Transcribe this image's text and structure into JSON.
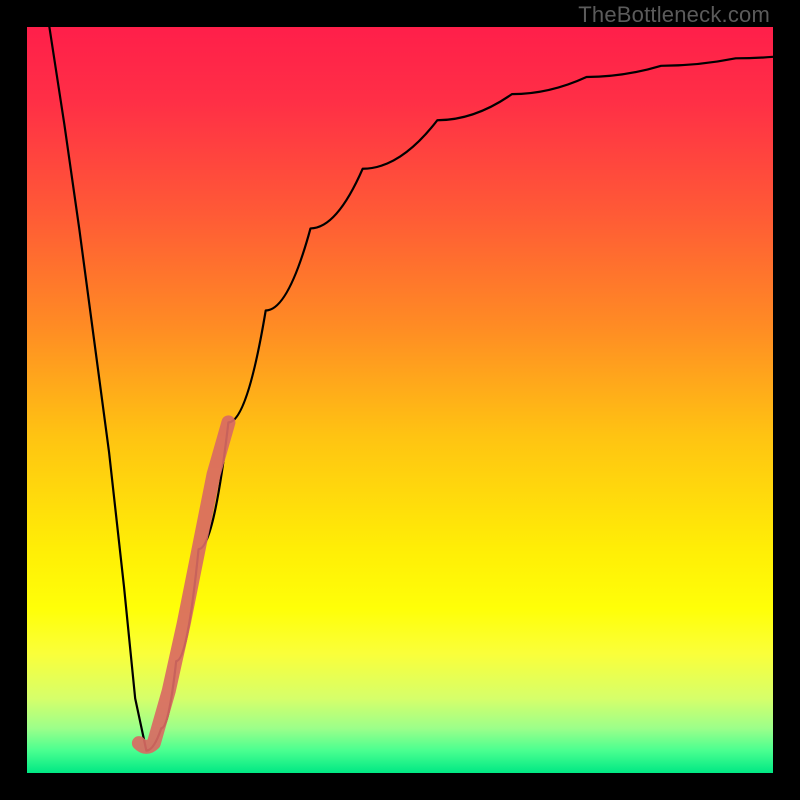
{
  "watermark": "TheBottleneck.com",
  "chart_data": {
    "type": "line",
    "title": "",
    "xlabel": "",
    "ylabel": "",
    "xlim": [
      0,
      100
    ],
    "ylim": [
      0,
      100
    ],
    "grid": false,
    "legend": false,
    "background_gradient_stops": [
      {
        "offset": 0.0,
        "color": "#ff1f4a"
      },
      {
        "offset": 0.1,
        "color": "#ff2f46"
      },
      {
        "offset": 0.25,
        "color": "#ff5a36"
      },
      {
        "offset": 0.4,
        "color": "#ff8b24"
      },
      {
        "offset": 0.55,
        "color": "#ffc412"
      },
      {
        "offset": 0.7,
        "color": "#ffee06"
      },
      {
        "offset": 0.78,
        "color": "#ffff08"
      },
      {
        "offset": 0.84,
        "color": "#faff3a"
      },
      {
        "offset": 0.9,
        "color": "#d6ff6a"
      },
      {
        "offset": 0.94,
        "color": "#9cff8a"
      },
      {
        "offset": 0.97,
        "color": "#4aff90"
      },
      {
        "offset": 1.0,
        "color": "#00e884"
      }
    ],
    "series": [
      {
        "name": "bottleneck-curve",
        "x": [
          3.0,
          5.0,
          7.0,
          9.0,
          11.0,
          13.0,
          14.5,
          16.0,
          18.0,
          20.0,
          23.0,
          27.0,
          32.0,
          38.0,
          45.0,
          55.0,
          65.0,
          75.0,
          85.0,
          95.0,
          100.0
        ],
        "y": [
          100.0,
          87.0,
          73.0,
          58.0,
          43.0,
          25.0,
          10.0,
          3.0,
          6.0,
          15.0,
          30.0,
          47.0,
          62.0,
          73.0,
          81.0,
          87.5,
          91.0,
          93.3,
          94.8,
          95.8,
          96.0
        ]
      },
      {
        "name": "highlight-segment",
        "x": [
          15.0,
          16.0,
          17.0,
          19.0,
          21.0,
          23.0,
          25.0,
          27.0
        ],
        "y": [
          4.0,
          3.0,
          4.0,
          11.0,
          20.0,
          30.0,
          40.0,
          47.0
        ]
      }
    ],
    "annotations": []
  }
}
